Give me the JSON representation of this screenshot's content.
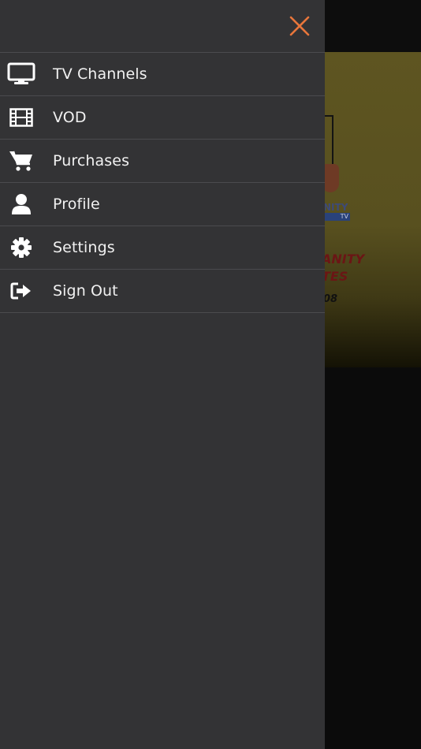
{
  "background": {
    "banner_logo_text": "NITY",
    "banner_logo_badge": "TV",
    "banner_title_line1": "ANITY",
    "banner_title_line2": "TES",
    "banner_number": "08"
  },
  "drawer": {
    "close_icon": "close-icon",
    "accent_color": "#e8763b",
    "items": [
      {
        "label": "TV Channels",
        "icon": "monitor-icon"
      },
      {
        "label": "VOD",
        "icon": "film-icon"
      },
      {
        "label": "Purchases",
        "icon": "cart-icon"
      },
      {
        "label": "Profile",
        "icon": "user-icon"
      },
      {
        "label": "Settings",
        "icon": "gear-icon"
      },
      {
        "label": "Sign Out",
        "icon": "sign-out-icon"
      }
    ]
  }
}
